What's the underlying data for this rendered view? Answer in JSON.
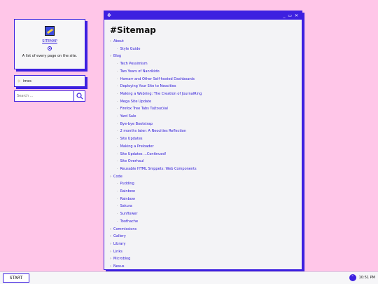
{
  "card": {
    "title": "SITEMAP",
    "desc": "A list of every page on the site."
  },
  "music": {
    "text": "imes"
  },
  "search": {
    "placeholder": "Search ..."
  },
  "window": {
    "title_icon": "✥",
    "controls": "_ ▭ ✕",
    "heading": "#Sitemap"
  },
  "sitemap": {
    "about": "About",
    "style_guide": "Style Guide",
    "blog": "Blog",
    "posts": [
      "Tech Pessimism",
      "Two Years of Nanrikido",
      "Homarr and Other Self-hosted Dashboards",
      "Deploying Your Site to Neocities",
      "Making a Webring: The Creation of JournalRing",
      "Mega Site Update",
      "Firefox Tree Tabs Tu(tour)ial",
      "Yard Sale",
      "Bye-bye Bootstrap",
      "2 months later: A Neocities Reflection",
      "Site Updates",
      "Making a Preloader",
      "Site Updates ...Continued!",
      "Site Overhaul",
      "Reusable HTML Snippets: Web Components"
    ],
    "code": "Code",
    "code_items": [
      "Pudding",
      "Rainbow",
      "Rainbow",
      "Sakura",
      "Sunflower",
      "Toothache"
    ],
    "tail": [
      "Commissions",
      "Gallery",
      "Library",
      "Links",
      "Microblog",
      "Nexus"
    ]
  },
  "taskbar": {
    "start": "START",
    "time": "10:51 PM"
  }
}
